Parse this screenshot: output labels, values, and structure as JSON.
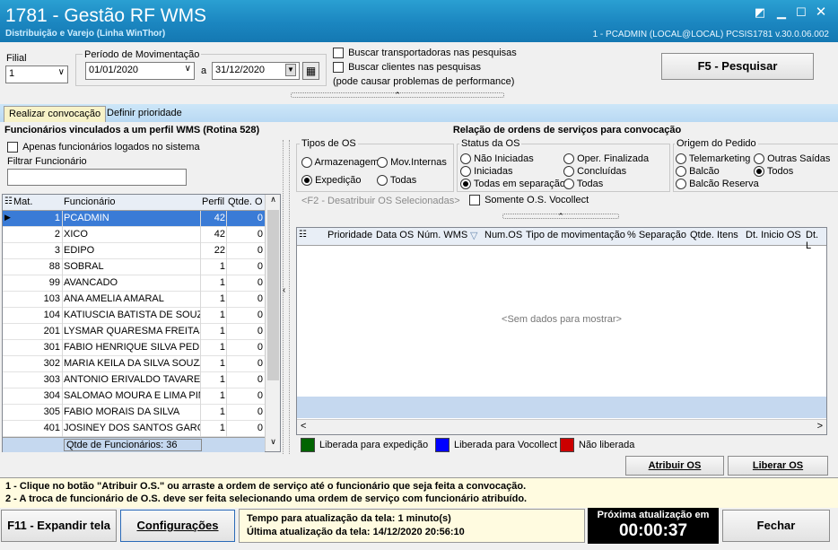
{
  "window": {
    "title": "1781 - Gestão RF WMS",
    "subtitle": "Distribuição e Varejo (Linha WinThor)",
    "user_info": "1 - PCADMIN (LOCAL@LOCAL)   PCSIS1781  v.30.0.06.002"
  },
  "filters": {
    "filial_label": "Filial",
    "filial_value": "1",
    "periodo_label": "Período de Movimentação",
    "date_from": "01/01/2020",
    "date_sep": "a",
    "date_to": "31/12/2020",
    "chk_transportadoras": "Buscar transportadoras nas pesquisas",
    "chk_clientes": "Buscar clientes nas pesquisas",
    "performance_note": "(pode causar problemas de performance)",
    "search_button": "F5 - Pesquisar"
  },
  "tabs": [
    "Realizar convocação",
    "Definir prioridade"
  ],
  "left_panel": {
    "title": "Funcionários vinculados a um perfil WMS  (Rotina 528)",
    "chk_logados": "Apenas funcionários logados no sistema",
    "filter_label": "Filtrar Funcionário",
    "filter_value": "",
    "columns": [
      "Mat.",
      "Funcionário",
      "Perfil",
      "Qtde. O"
    ],
    "rows": [
      {
        "mat": "1",
        "name": "PCADMIN",
        "perfil": "42",
        "qtde": "0"
      },
      {
        "mat": "2",
        "name": "XICO",
        "perfil": "42",
        "qtde": "0"
      },
      {
        "mat": "3",
        "name": "EDIPO",
        "perfil": "22",
        "qtde": "0"
      },
      {
        "mat": "88",
        "name": "SOBRAL",
        "perfil": "1",
        "qtde": "0"
      },
      {
        "mat": "99",
        "name": "AVANCADO",
        "perfil": "1",
        "qtde": "0"
      },
      {
        "mat": "103",
        "name": "ANA AMELIA AMARAL",
        "perfil": "1",
        "qtde": "0"
      },
      {
        "mat": "104",
        "name": "KATIUSCIA BATISTA DE SOUZA",
        "perfil": "1",
        "qtde": "0"
      },
      {
        "mat": "201",
        "name": "LYSMAR QUARESMA FREITAS",
        "perfil": "1",
        "qtde": "0"
      },
      {
        "mat": "301",
        "name": "FABIO HENRIQUE SILVA PEDRI",
        "perfil": "1",
        "qtde": "0"
      },
      {
        "mat": "302",
        "name": "MARIA KEILA DA SILVA SOUZA",
        "perfil": "1",
        "qtde": "0"
      },
      {
        "mat": "303",
        "name": "ANTONIO ERIVALDO TAVARES",
        "perfil": "1",
        "qtde": "0"
      },
      {
        "mat": "304",
        "name": "SALOMAO MOURA E LIMA PINT",
        "perfil": "1",
        "qtde": "0"
      },
      {
        "mat": "305",
        "name": "FABIO MORAIS DA SILVA",
        "perfil": "1",
        "qtde": "0"
      },
      {
        "mat": "401",
        "name": "JOSINEY DOS SANTOS GARCIA",
        "perfil": "1",
        "qtde": "0"
      }
    ],
    "footer": "Qtde de Funcionários: 36"
  },
  "right_panel": {
    "title": "Relação de ordens de serviços para convocação",
    "tipos_label": "Tipos de OS",
    "tipos": [
      "Armazenagem",
      "Mov.Internas",
      "Expedição",
      "Todas"
    ],
    "tipos_selected": "Expedição",
    "status_label": "Status da OS",
    "status": [
      "Não Iniciadas",
      "Oper. Finalizada",
      "Iniciadas",
      "Concluídas",
      "Todas em separação",
      "Todas"
    ],
    "status_selected": "Todas em separação",
    "origem_label": "Origem do Pedido",
    "origem": [
      "Telemarketing",
      "Outras Saídas",
      "Balcão",
      "Todos",
      "Balcão Reserva"
    ],
    "origem_selected": "Todos",
    "f2_link": "<F2  - Desatribuir OS Selecionadas>",
    "chk_vocollect": "Somente O.S. Vocollect",
    "columns": [
      "Prioridade",
      "Data OS",
      "Núm. WMS",
      "Num.OS",
      "Tipo de movimentação",
      "% Separação",
      "Qtde. Itens",
      "Dt. Inicio OS",
      "Dt. L"
    ],
    "empty_text": "<Sem dados para mostrar>",
    "legend": [
      {
        "label": "Liberada para expedição",
        "color": "#006400"
      },
      {
        "label": "Liberada para Vocollect",
        "color": "#0000ff"
      },
      {
        "label": "Não liberada",
        "color": "#cc0000"
      }
    ],
    "btn_atribuir": "Atribuir OS",
    "btn_liberar": "Liberar OS"
  },
  "help": {
    "line1": "1 - Clique no botão \"Atribuir O.S.\" ou arraste a ordem de serviço até o funcionário que seja feita a convocação.",
    "line2": "2 - A troca de funcionário de O.S. deve ser feita selecionando uma ordem de serviço com funcionário atribuído."
  },
  "bottom": {
    "expand_button": "F11 - Expandir tela",
    "config_button": "Configurações",
    "update_interval": "Tempo para atualização da tela: 1 minuto(s)",
    "last_update": "Última atualização da tela: 14/12/2020 20:56:10",
    "next_label": "Próxima atualização em",
    "countdown": "00:00:37",
    "close_button": "Fechar"
  }
}
